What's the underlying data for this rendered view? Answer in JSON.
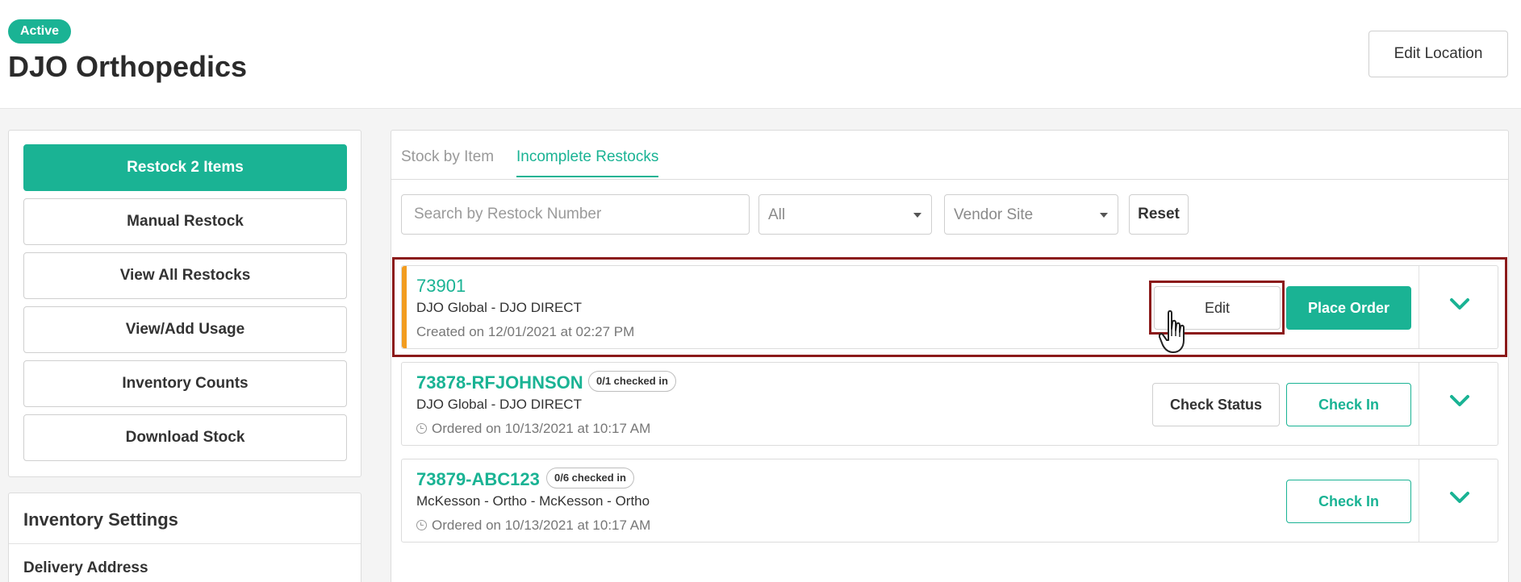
{
  "header": {
    "status_badge": "Active",
    "title": "DJO Orthopedics",
    "edit_location_label": "Edit Location"
  },
  "sidebar": {
    "actions": [
      {
        "label": "Restock 2 Items"
      },
      {
        "label": "Manual Restock"
      },
      {
        "label": "View All Restocks"
      },
      {
        "label": "View/Add Usage"
      },
      {
        "label": "Inventory Counts"
      },
      {
        "label": "Download Stock"
      }
    ],
    "settings_title": "Inventory Settings",
    "settings_items": [
      {
        "label": "Delivery Address"
      }
    ]
  },
  "tabs": [
    {
      "label": "Stock by Item",
      "active": false
    },
    {
      "label": "Incomplete Restocks",
      "active": true
    }
  ],
  "filters": {
    "search_placeholder": "Search by Restock Number",
    "status_select": "All",
    "vendor_select_placeholder": "Vendor Site",
    "reset_label": "Reset"
  },
  "restocks": [
    {
      "number": "73901",
      "vendor": "DJO Global - DJO DIRECT",
      "meta": "Created on 12/01/2021 at 02:27 PM",
      "buttons": {
        "edit": "Edit",
        "place_order": "Place Order"
      }
    },
    {
      "number": "73878-RFJOHNSON",
      "checked_badge": "0/1 checked in",
      "vendor": "DJO Global - DJO DIRECT",
      "meta": "Ordered on 10/13/2021 at 10:17 AM",
      "buttons": {
        "check_status": "Check Status",
        "check_in": "Check In"
      }
    },
    {
      "number": "73879-ABC123",
      "checked_badge": "0/6 checked in",
      "vendor": "McKesson - Ortho - McKesson - Ortho",
      "meta": "Ordered on 10/13/2021 at 10:17 AM",
      "buttons": {
        "check_in": "Check In"
      }
    }
  ],
  "colors": {
    "accent": "#1ab394",
    "pending_stripe": "#f29c1f",
    "highlight": "#8b1a1a"
  }
}
